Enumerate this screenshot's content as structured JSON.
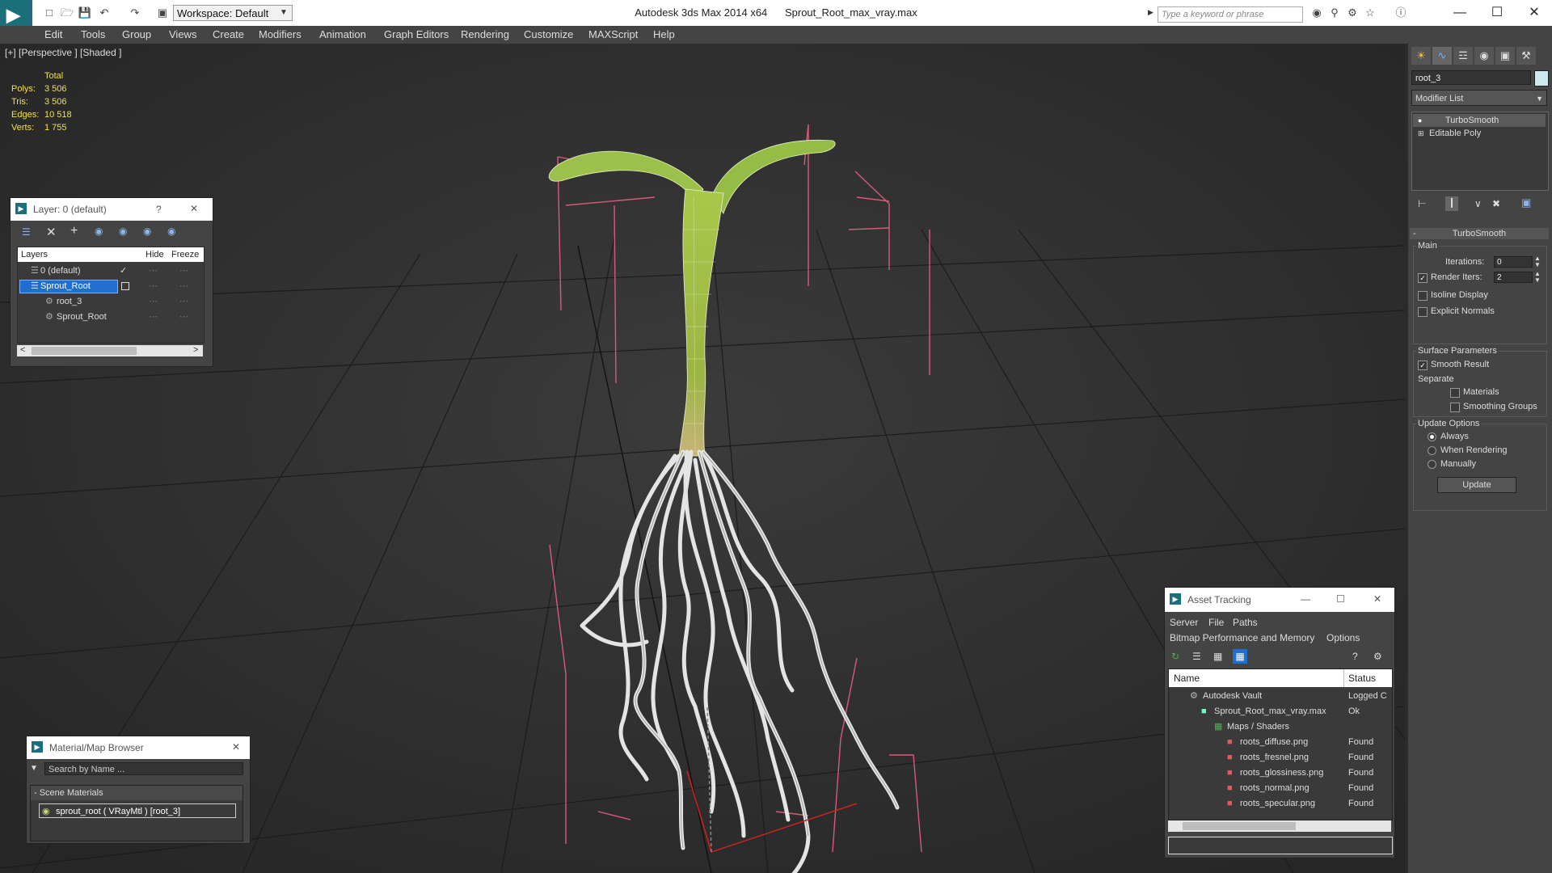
{
  "titlebar": {
    "app_title": "Autodesk 3ds Max  2014 x64",
    "file_title": "Sprout_Root_max_vray.max",
    "workspace": "Workspace: Default",
    "search_placeholder": "Type a keyword or phrase",
    "minimize": "—",
    "maximize": "☐",
    "close": "✕"
  },
  "menu": [
    "Edit",
    "Tools",
    "Group",
    "Views",
    "Create",
    "Modifiers",
    "Animation",
    "Graph Editors",
    "Rendering",
    "Customize",
    "MAXScript",
    "Help"
  ],
  "viewport": {
    "label": "[+] [Perspective ] [Shaded ]",
    "stats_header": "Total",
    "stats": [
      {
        "label": "Polys:",
        "value": "3 506"
      },
      {
        "label": "Tris:",
        "value": "3 506"
      },
      {
        "label": "Edges:",
        "value": "10 518"
      },
      {
        "label": "Verts:",
        "value": "1 755"
      }
    ]
  },
  "layer_panel": {
    "title": "Layer: 0 (default)",
    "help": "?",
    "close": "✕",
    "col_layers": "Layers",
    "col_hide": "Hide",
    "col_freeze": "Freeze",
    "rows": [
      {
        "name": "0 (default)",
        "indent": 0,
        "selected": false,
        "checked": true
      },
      {
        "name": "Sprout_Root",
        "indent": 0,
        "selected": true,
        "checked": false
      },
      {
        "name": "root_3",
        "indent": 1,
        "selected": false,
        "checked": false
      },
      {
        "name": "Sprout_Root",
        "indent": 1,
        "selected": false,
        "checked": false
      }
    ],
    "scroll_left": "<",
    "scroll_right": ">"
  },
  "material_browser": {
    "title": "Material/Map Browser",
    "close": "✕",
    "search_placeholder": "Search by Name ...",
    "section": "- Scene Materials",
    "item": "sprout_root  ( VRayMtl ) [root_3]"
  },
  "asset_tracking": {
    "title": "Asset Tracking",
    "minimize": "—",
    "maximize": "☐",
    "close": "✕",
    "menu1": [
      "Server",
      "File",
      "Paths"
    ],
    "menu2": [
      "Bitmap Performance and Memory",
      "Options"
    ],
    "col_name": "Name",
    "col_status": "Status",
    "rows": [
      {
        "name": "Autodesk Vault",
        "status": "Logged C",
        "indent": 1
      },
      {
        "name": "Sprout_Root_max_vray.max",
        "status": "Ok",
        "indent": 2
      },
      {
        "name": "Maps / Shaders",
        "status": "",
        "indent": 3
      },
      {
        "name": "roots_diffuse.png",
        "status": "Found",
        "indent": 4
      },
      {
        "name": "roots_fresnel.png",
        "status": "Found",
        "indent": 4
      },
      {
        "name": "roots_glossiness.png",
        "status": "Found",
        "indent": 4
      },
      {
        "name": "roots_normal.png",
        "status": "Found",
        "indent": 4
      },
      {
        "name": "roots_specular.png",
        "status": "Found",
        "indent": 4
      }
    ]
  },
  "command_panel": {
    "object_name": "root_3",
    "modifier_list": "Modifier List",
    "stack": [
      "TurboSmooth",
      "Editable Poly"
    ],
    "rollout_title": "TurboSmooth",
    "main_label": "Main",
    "iterations_label": "Iterations:",
    "iterations_value": "0",
    "render_iters_label": "Render Iters:",
    "render_iters_value": "2",
    "isoline": "Isoline Display",
    "explicit_normals": "Explicit Normals",
    "surface_params": "Surface Parameters",
    "smooth_result": "Smooth Result",
    "separate": "Separate",
    "materials": "Materials",
    "smoothing_groups": "Smoothing Groups",
    "update_options": "Update Options",
    "always": "Always",
    "when_rendering": "When Rendering",
    "manually": "Manually",
    "update_button": "Update"
  },
  "colors": {
    "accent_blue": "#1f6fd1",
    "stats_yellow": "#f2e04a",
    "bounding_box_pink": "#d85a7a",
    "stem_green": "#9cbf3c"
  }
}
